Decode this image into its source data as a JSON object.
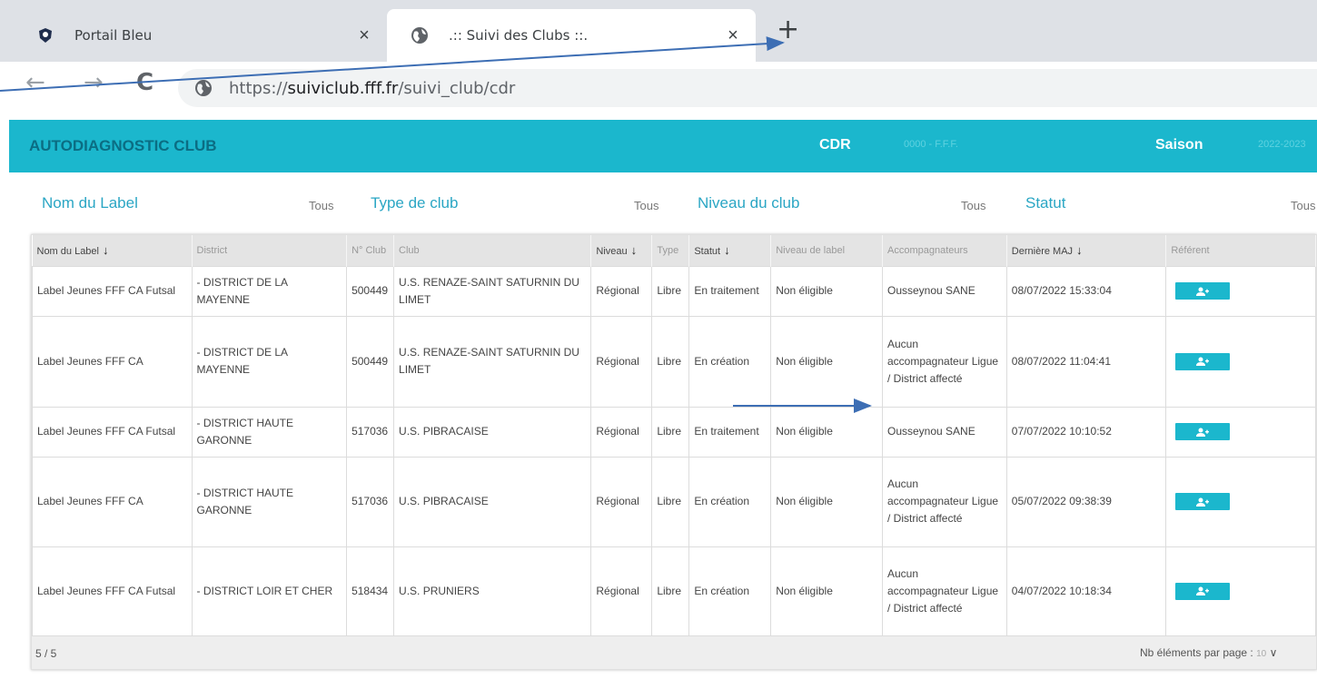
{
  "browser": {
    "tabs": [
      {
        "title": "Portail Bleu",
        "close": "×"
      },
      {
        "title": ".:: Suivi des Clubs ::.",
        "close": "×"
      }
    ],
    "new_tab": "+",
    "back": "←",
    "forward": "→",
    "reload": "C",
    "url_prefix": "https://",
    "url_domain": "suiviclub.fff.fr",
    "url_path": "/suivi_club/cdr"
  },
  "app": {
    "title": "AUTODIAGNOSTIC CLUB",
    "cdr_label": "CDR",
    "cdr_value": "0000 - F.F.F.",
    "saison_label": "Saison",
    "saison_value": "2022-2023",
    "colors": {
      "header": "#1bb7cd",
      "title": "#0b6d83",
      "filter_label": "#2aa6c4",
      "button": "#1bb7cd"
    }
  },
  "filters": [
    {
      "label": "Nom du Label",
      "value": "Tous"
    },
    {
      "label": "Type de club",
      "value": "Tous"
    },
    {
      "label": "Niveau du club",
      "value": "Tous"
    },
    {
      "label": "Statut",
      "value": "Tous"
    }
  ],
  "table": {
    "headers": {
      "nom_label": "Nom du Label",
      "district": "District",
      "num_club": "N° Club",
      "club": "Club",
      "niveau": "Niveau",
      "type": "Type",
      "statut": "Statut",
      "niveau_label": "Niveau de label",
      "accompagnateurs": "Accompagnateurs",
      "derniere_maj": "Dernière MAJ",
      "referent": "Référent"
    },
    "sort_arrow": "↓",
    "rows": [
      {
        "nom_label": "Label Jeunes FFF CA Futsal",
        "district": "- DISTRICT DE LA MAYENNE",
        "num_club": "500449",
        "club": "U.S. RENAZE-SAINT SATURNIN DU LIMET",
        "niveau": "Régional",
        "type": "Libre",
        "statut": "En traitement",
        "niveau_label": "Non éligible",
        "accompagnateurs": "Ousseynou SANE",
        "derniere_maj": "08/07/2022 15:33:04"
      },
      {
        "nom_label": "Label Jeunes FFF CA",
        "district": "- DISTRICT DE LA MAYENNE",
        "num_club": "500449",
        "club": "U.S. RENAZE-SAINT SATURNIN DU LIMET",
        "niveau": "Régional",
        "type": "Libre",
        "statut": "En création",
        "niveau_label": "Non éligible",
        "accompagnateurs": "Aucun accompagnateur Ligue / District affecté",
        "derniere_maj": "08/07/2022 11:04:41"
      },
      {
        "nom_label": "Label Jeunes FFF CA Futsal",
        "district": "- DISTRICT HAUTE GARONNE",
        "num_club": "517036",
        "club": "U.S. PIBRACAISE",
        "niveau": "Régional",
        "type": "Libre",
        "statut": "En traitement",
        "niveau_label": "Non éligible",
        "accompagnateurs": "Ousseynou SANE",
        "derniere_maj": "07/07/2022 10:10:52"
      },
      {
        "nom_label": "Label Jeunes FFF CA",
        "district": "- DISTRICT HAUTE GARONNE",
        "num_club": "517036",
        "club": "U.S. PIBRACAISE",
        "niveau": "Régional",
        "type": "Libre",
        "statut": "En création",
        "niveau_label": "Non éligible",
        "accompagnateurs": "Aucun accompagnateur Ligue / District affecté",
        "derniere_maj": "05/07/2022 09:38:39"
      },
      {
        "nom_label": "Label Jeunes FFF CA Futsal",
        "district": "- DISTRICT LOIR ET CHER",
        "num_club": "518434",
        "club": "U.S. PRUNIERS",
        "niveau": "Régional",
        "type": "Libre",
        "statut": "En création",
        "niveau_label": "Non éligible",
        "accompagnateurs": "Aucun accompagnateur Ligue / District affecté",
        "derniere_maj": "04/07/2022 10:18:34"
      }
    ],
    "footer": {
      "count": "5 / 5",
      "per_page_label": "Nb éléments par page :",
      "per_page_value": "10",
      "dropdown": "∨"
    }
  }
}
